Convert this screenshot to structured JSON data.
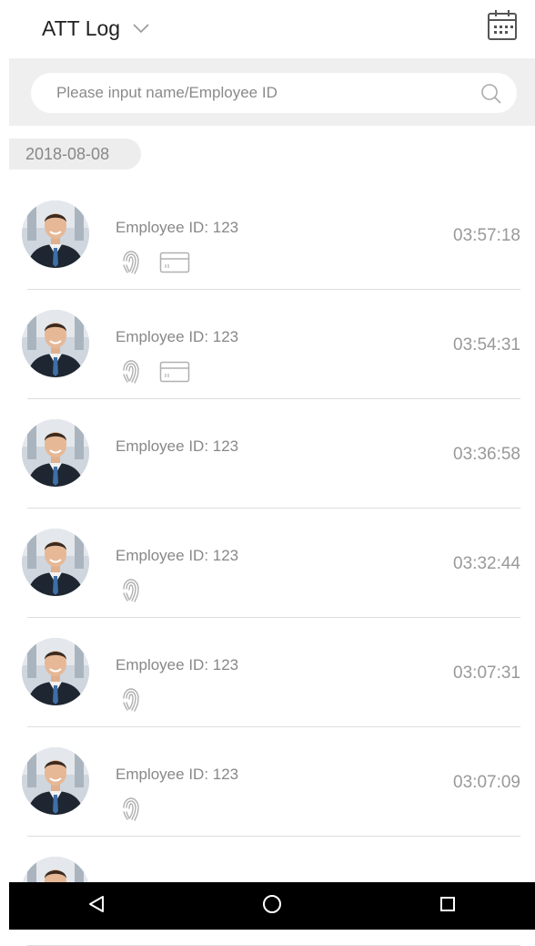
{
  "header": {
    "title": "ATT Log",
    "dropdown_icon": "chevron-down-icon",
    "calendar_icon": "calendar-icon"
  },
  "search": {
    "placeholder": "Please input name/Employee ID",
    "value": "",
    "icon": "search-icon"
  },
  "date_group": "2018-08-08",
  "records": [
    {
      "employee": "Employee ID: 123",
      "time": "03:57:18",
      "methods": [
        "fingerprint-icon",
        "card-icon"
      ]
    },
    {
      "employee": "Employee ID: 123",
      "time": "03:54:31",
      "methods": [
        "fingerprint-icon",
        "card-icon"
      ]
    },
    {
      "employee": "Employee ID: 123",
      "time": "03:36:58",
      "methods": []
    },
    {
      "employee": "Employee ID: 123",
      "time": "03:32:44",
      "methods": [
        "fingerprint-icon"
      ]
    },
    {
      "employee": "Employee ID: 123",
      "time": "03:07:31",
      "methods": [
        "fingerprint-icon"
      ]
    },
    {
      "employee": "Employee ID: 123",
      "time": "03:07:09",
      "methods": [
        "fingerprint-icon"
      ]
    },
    {
      "employee": "",
      "time": "",
      "methods": []
    }
  ],
  "navbar": {
    "buttons": [
      "back-icon",
      "home-icon",
      "recents-icon"
    ]
  },
  "colors": {
    "search_bg": "#efefef",
    "date_tag_bg": "#ededed",
    "text_muted": "#888888",
    "icon_gray": "#b0b0b0",
    "navbar_bg": "#000000"
  }
}
